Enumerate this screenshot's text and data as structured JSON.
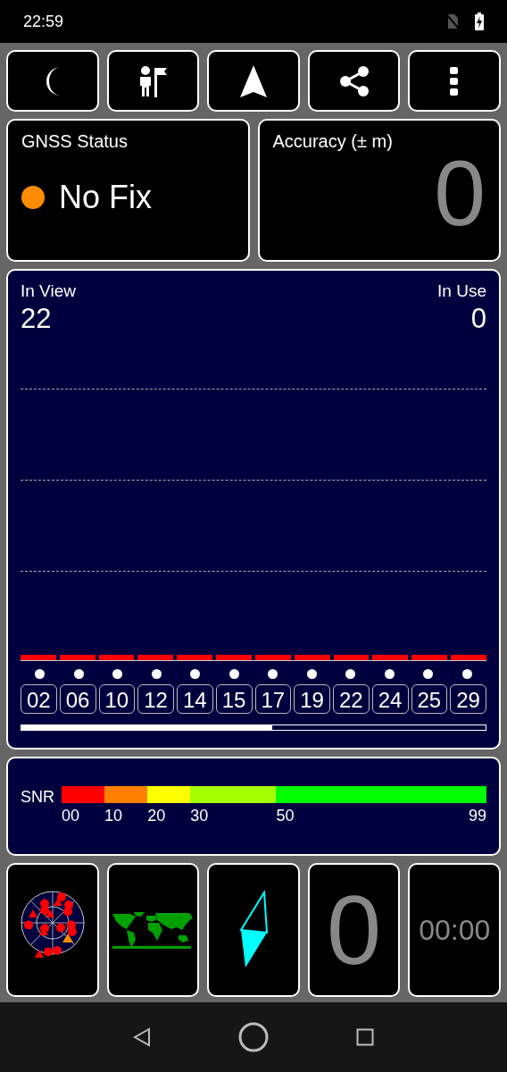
{
  "status_bar": {
    "time": "22:59"
  },
  "toolbar": [
    {
      "kind": "moon"
    },
    {
      "kind": "person-flag"
    },
    {
      "kind": "navigation"
    },
    {
      "kind": "share"
    },
    {
      "kind": "more"
    }
  ],
  "gnss_status": {
    "title": "GNSS Status",
    "fix": "No Fix",
    "color": "#ff8c00"
  },
  "accuracy": {
    "title": "Accuracy (± m)",
    "value": "0"
  },
  "satellites": {
    "in_view_label": "In View",
    "in_view": "22",
    "in_use_label": "In Use",
    "in_use": "0",
    "items": [
      {
        "prn": "02"
      },
      {
        "prn": "06"
      },
      {
        "prn": "10"
      },
      {
        "prn": "12"
      },
      {
        "prn": "14"
      },
      {
        "prn": "15"
      },
      {
        "prn": "17"
      },
      {
        "prn": "19"
      },
      {
        "prn": "22"
      },
      {
        "prn": "24"
      },
      {
        "prn": "25"
      },
      {
        "prn": "29"
      }
    ]
  },
  "snr": {
    "label": "SNR",
    "segments": [
      {
        "start": "00",
        "color": "#ff0000"
      },
      {
        "start": "10",
        "color": "#ff8000"
      },
      {
        "start": "20",
        "color": "#ffff00"
      },
      {
        "start": "30",
        "color": "#a6ff00"
      },
      {
        "start": "50",
        "color": "#00ff00"
      }
    ],
    "end": "99"
  },
  "tiles": [
    {
      "kind": "radar"
    },
    {
      "kind": "map"
    },
    {
      "kind": "compass"
    },
    {
      "kind": "number",
      "text": "0"
    },
    {
      "kind": "timer",
      "text": "00:00"
    }
  ]
}
